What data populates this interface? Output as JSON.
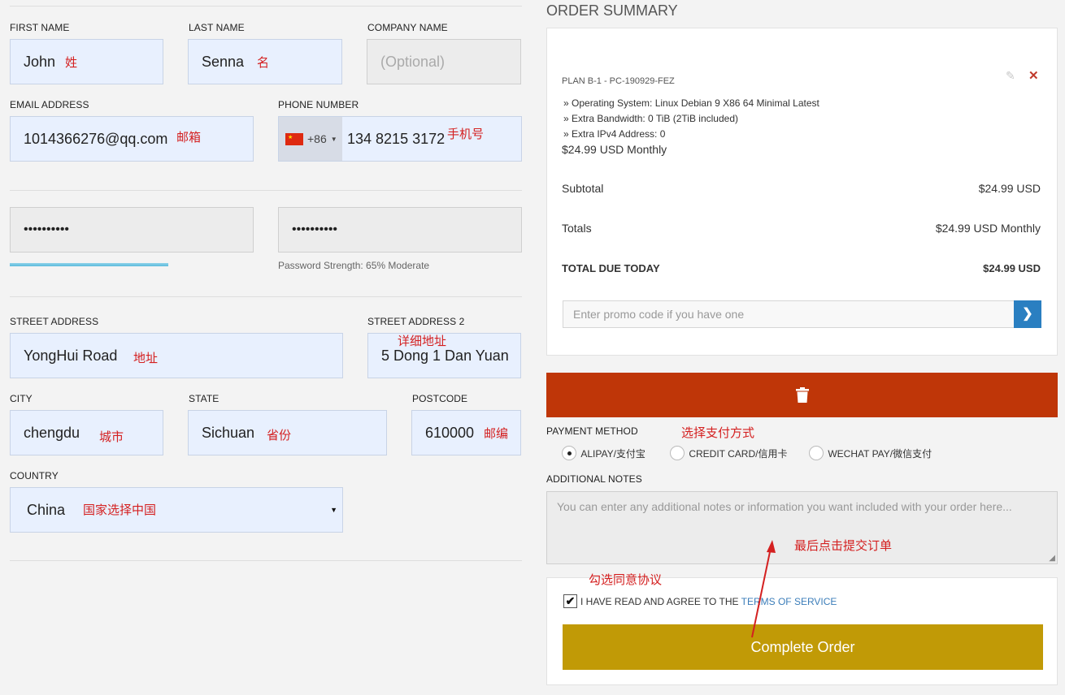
{
  "form": {
    "first_name": {
      "label": "FIRST NAME",
      "value": "John",
      "note": "姓"
    },
    "last_name": {
      "label": "LAST NAME",
      "value": "Senna",
      "note": "名"
    },
    "company_name": {
      "label": "COMPANY NAME",
      "placeholder": "(Optional)"
    },
    "email": {
      "label": "EMAIL ADDRESS",
      "value": "1014366276@qq.com",
      "note": "邮箱"
    },
    "phone": {
      "label": "PHONE NUMBER",
      "dial_code": "+86",
      "value": "134 8215 3172",
      "note": "手机号"
    },
    "password": {
      "value": "••••••••••"
    },
    "password_confirm": {
      "value": "••••••••••"
    },
    "password_strength": {
      "text": "Password Strength: 65% Moderate",
      "level_percent": 65
    },
    "street": {
      "label": "STREET ADDRESS",
      "value": "YongHui Road",
      "note": "地址"
    },
    "street2": {
      "label": "STREET ADDRESS 2",
      "value": "5 Dong 1 Dan Yuan",
      "note": "详细地址"
    },
    "city": {
      "label": "CITY",
      "value": "chengdu",
      "note": "城市"
    },
    "state": {
      "label": "STATE",
      "value": "Sichuan",
      "note": "省份"
    },
    "postcode": {
      "label": "POSTCODE",
      "value": "610000",
      "note": "邮编"
    },
    "country": {
      "label": "COUNTRY",
      "value": "China",
      "note": "国家选择中国"
    }
  },
  "summary": {
    "title": "ORDER SUMMARY",
    "plan": "PLAN B-1 - PC-190929-FEZ",
    "details": [
      "» Operating System: Linux Debian 9 X86 64 Minimal Latest",
      "» Extra Bandwidth: 0 TiB (2TiB included)",
      "» Extra IPv4 Address: 0"
    ],
    "price": "$24.99 USD Monthly",
    "subtotal_label": "Subtotal",
    "subtotal_value": "$24.99 USD",
    "totals_label": "Totals",
    "totals_value": "$24.99 USD Monthly",
    "due_label": "TOTAL DUE TODAY",
    "due_value": "$24.99 USD",
    "promo_placeholder": "Enter promo code if you have one"
  },
  "payment": {
    "label": "PAYMENT METHOD",
    "note": "选择支付方式",
    "options": [
      "ALIPAY/支付宝",
      "CREDIT CARD/信用卡",
      "WECHAT PAY/微信支付"
    ],
    "selected": 0
  },
  "notes": {
    "label": "ADDITIONAL NOTES",
    "placeholder": "You can enter any additional notes or information you want included with your order here...",
    "annotation": "最后点击提交订单"
  },
  "terms": {
    "annotation": "勾选同意协议",
    "text": "I HAVE READ AND AGREE TO THE ",
    "link": "TERMS OF SERVICE"
  },
  "complete_button": "Complete Order",
  "colors": {
    "input_bg": "#e8f0fe",
    "delete_bar": "#bf3608",
    "complete_btn": "#c19a06",
    "promo_btn": "#2a7fc1",
    "annotation": "#d42020",
    "link": "#3b7db9"
  }
}
